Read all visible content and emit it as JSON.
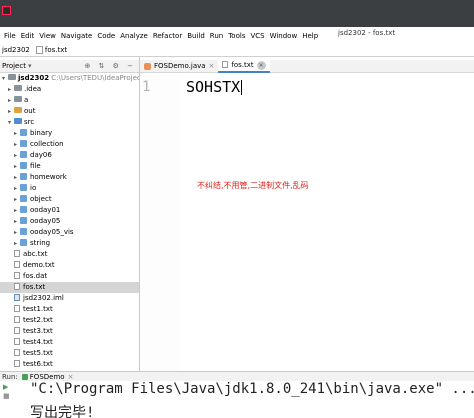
{
  "window": {
    "title": "jsd2302 - fos.txt"
  },
  "menu": {
    "items": [
      "File",
      "Edit",
      "View",
      "Navigate",
      "Code",
      "Analyze",
      "Refactor",
      "Build",
      "Run",
      "Tools",
      "VCS",
      "Window",
      "Help"
    ]
  },
  "breadcrumb": {
    "project": "jsd2302",
    "file": "fos.txt"
  },
  "project_panel": {
    "header": "Project",
    "root": "jsd2302",
    "root_path": "C:\\Users\\TEDU\\IdeaProjects\\jsd",
    "items": [
      ".idea",
      "a",
      "out",
      "src",
      "binary",
      "collection",
      "day06",
      "file",
      "homework",
      "io",
      "object",
      "ooday01",
      "ooday05",
      "ooday05_vis",
      "string",
      "abc.txt",
      "demo.txt",
      "fos.dat",
      "fos.txt",
      "jsd2302.iml",
      "test1.txt",
      "test2.txt",
      "test3.txt",
      "test4.txt",
      "test5.txt",
      "test6.txt"
    ]
  },
  "editor": {
    "tabs": [
      {
        "label": "FOSDemo.java"
      },
      {
        "label": "fos.txt"
      }
    ],
    "line_number": "1",
    "code": "SOHSTX",
    "annotation": "不纠结,不用管,二进制文件,乱码"
  },
  "run_panel": {
    "label": "Run:",
    "tab": "FOSDemo",
    "lines": [
      "\"C:\\Program Files\\Java\\jdk1.8.0_241\\bin\\java.exe\" ...",
      "写出完毕!"
    ]
  },
  "colors": {
    "annotation": "#e3201b",
    "active_tab_underline": "#4083c9",
    "selection": "#d5d5d5"
  }
}
